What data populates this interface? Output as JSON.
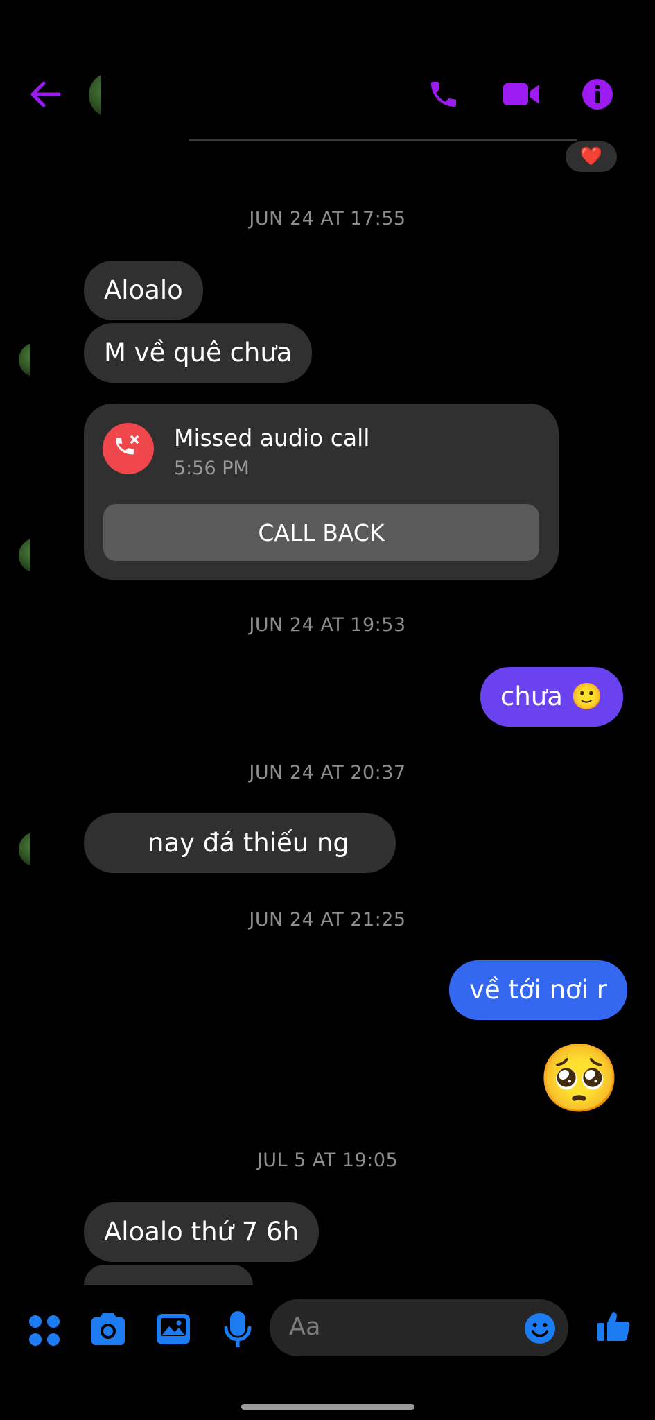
{
  "header": {
    "back_icon": "arrow-left-icon",
    "actions": [
      {
        "name": "audio-call",
        "icon": "phone-icon"
      },
      {
        "name": "video-call",
        "icon": "video-camera-icon"
      },
      {
        "name": "info",
        "icon": "info-icon"
      }
    ],
    "accent_color": "#9b1bf2"
  },
  "reaction": {
    "emoji": "❤️"
  },
  "messages": {
    "ts1": "JUN 24 AT 17:55",
    "m1": "Aloalo",
    "m2": "M về quê chưa",
    "call": {
      "title": "Missed audio call",
      "time": "5:56 PM",
      "button": "CALL BACK",
      "icon": "missed-call-icon",
      "icon_color": "#f0474c"
    },
    "ts2": "JUN 24 AT 19:53",
    "m3": "chưa",
    "m3_emoji": "🙂",
    "ts3": "JUN 24 AT 20:37",
    "m4": "nay đá thiếu ng",
    "ts4": "JUN 24 AT 21:25",
    "m5": "về tới nơi r",
    "m6_emoji": "🥺",
    "ts5": "JUL 5 AT 19:05",
    "m7": "Aloalo thứ 7 6h"
  },
  "composer": {
    "placeholder": "Aa",
    "left_icons": [
      "menu-dots-icon",
      "camera-icon",
      "gallery-icon",
      "microphone-icon"
    ],
    "emoji_icon": "emoji-icon",
    "send_icon": "thumbs-up-icon",
    "accent_color": "#1e7cf2"
  },
  "colors": {
    "outgoing_top": "#7b3ff0",
    "outgoing_bottom": "#3568f0",
    "incoming": "#303030"
  }
}
